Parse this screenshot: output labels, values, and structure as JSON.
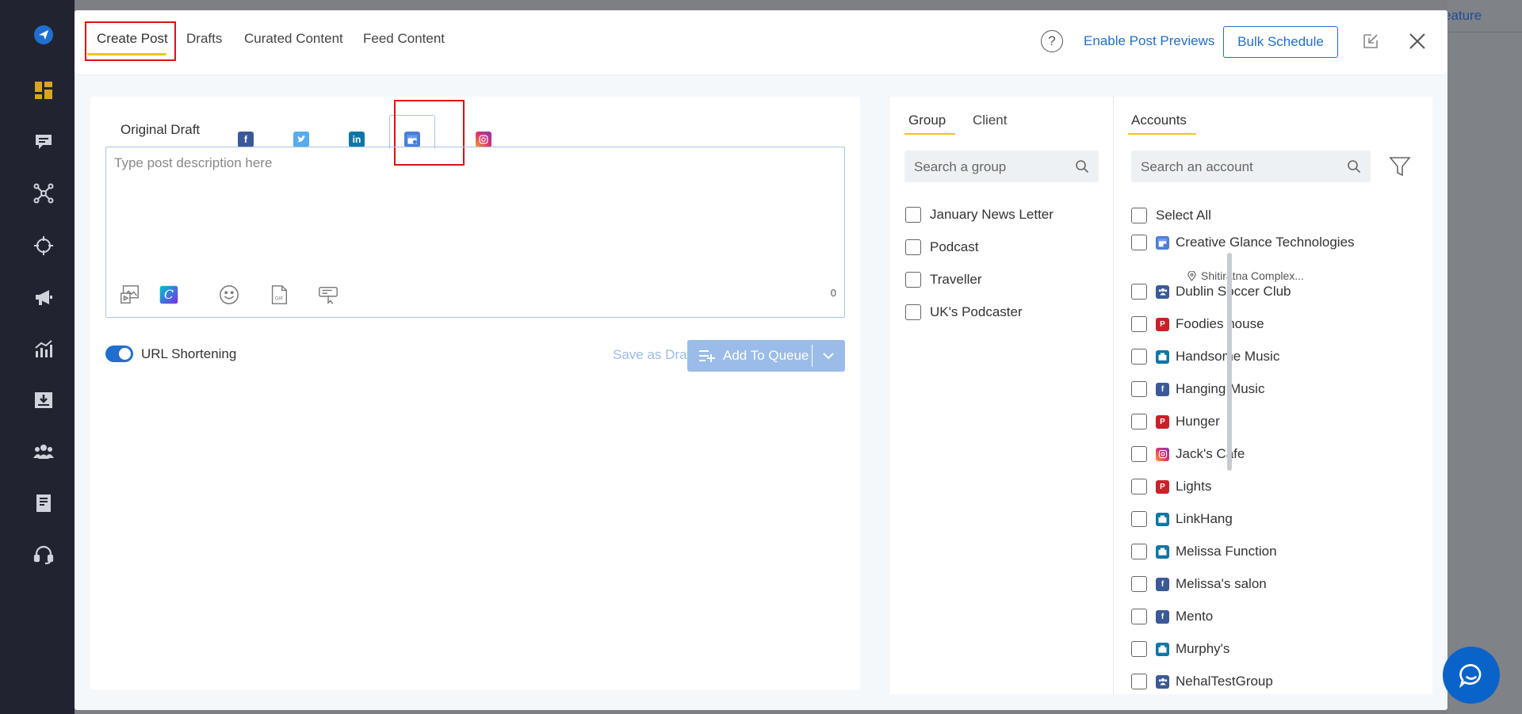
{
  "sidebar": {
    "icons": [
      "send-icon",
      "dashboard-icon",
      "messages-icon",
      "network-icon",
      "target-icon",
      "megaphone-icon",
      "analytics-icon",
      "inbox-download-icon",
      "team-icon",
      "reports-icon",
      "support-icon"
    ]
  },
  "background": {
    "feature_text": "eature"
  },
  "header": {
    "tabs": [
      "Create Post",
      "Drafts",
      "Curated Content",
      "Feed Content"
    ],
    "help": "?",
    "enable_previews": "Enable Post Previews",
    "bulk_schedule": "Bulk Schedule"
  },
  "editor": {
    "original_draft": "Original Draft",
    "network_tabs": [
      "facebook",
      "twitter",
      "linkedin",
      "google-my-business",
      "instagram"
    ],
    "placeholder": "Type post description here",
    "char_count": "0",
    "url_shortening_label": "URL Shortening",
    "url_shortening_on": true,
    "save_draft": "Save as Draft",
    "add_to_queue": "Add To Queue"
  },
  "groups": {
    "tabs": [
      "Group",
      "Client"
    ],
    "search_placeholder": "Search a group",
    "items": [
      "January News Letter",
      "Podcast",
      "Traveller",
      "UK's Podcaster"
    ]
  },
  "accounts": {
    "tab": "Accounts",
    "search_placeholder": "Search an account",
    "select_all": "Select All",
    "items": [
      {
        "name": "Creative Glance Technologies",
        "network": "google-my-business",
        "sub": "Shitiratna Complex..."
      },
      {
        "name": "Dublin Soccer Club",
        "network": "facebook-group"
      },
      {
        "name": "Foodies house",
        "network": "pinterest"
      },
      {
        "name": "Handsome Music",
        "network": "linkedin-page"
      },
      {
        "name": "Hanging Music",
        "network": "facebook"
      },
      {
        "name": "Hunger",
        "network": "pinterest"
      },
      {
        "name": "Jack's Cafe",
        "network": "instagram"
      },
      {
        "name": "Lights",
        "network": "pinterest"
      },
      {
        "name": "LinkHang",
        "network": "linkedin-page"
      },
      {
        "name": "Melissa Function",
        "network": "linkedin-page"
      },
      {
        "name": "Melissa's salon",
        "network": "facebook"
      },
      {
        "name": "Mento",
        "network": "facebook"
      },
      {
        "name": "Murphy's",
        "network": "linkedin-page"
      },
      {
        "name": "NehalTestGroup",
        "network": "facebook-group"
      }
    ]
  },
  "colors": {
    "accent": "#1f6fd1",
    "underline": "#f2c21b",
    "highlight_box": "#e01010",
    "facebook": "#3b5998",
    "twitter": "#55acee",
    "linkedin": "#0e76a8",
    "pinterest": "#cb2027",
    "instagram": "#e1306c",
    "gmb": "#4a7fd8"
  }
}
